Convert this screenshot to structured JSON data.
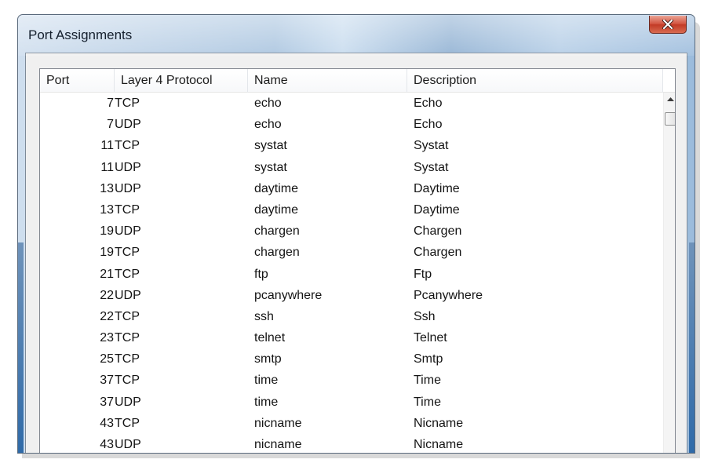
{
  "window": {
    "title": "Port Assignments",
    "close_icon": "close-x-icon"
  },
  "table": {
    "columns": [
      "Port",
      "Layer 4 Protocol",
      "Name",
      "Description"
    ],
    "rows": [
      {
        "port": "7",
        "protocol": "TCP",
        "name": "echo",
        "description": "Echo"
      },
      {
        "port": "7",
        "protocol": "UDP",
        "name": "echo",
        "description": "Echo"
      },
      {
        "port": "11",
        "protocol": "TCP",
        "name": "systat",
        "description": "Systat"
      },
      {
        "port": "11",
        "protocol": "UDP",
        "name": "systat",
        "description": "Systat"
      },
      {
        "port": "13",
        "protocol": "UDP",
        "name": "daytime",
        "description": "Daytime"
      },
      {
        "port": "13",
        "protocol": "TCP",
        "name": "daytime",
        "description": "Daytime"
      },
      {
        "port": "19",
        "protocol": "UDP",
        "name": "chargen",
        "description": "Chargen"
      },
      {
        "port": "19",
        "protocol": "TCP",
        "name": "chargen",
        "description": "Chargen"
      },
      {
        "port": "21",
        "protocol": "TCP",
        "name": "ftp",
        "description": "Ftp"
      },
      {
        "port": "22",
        "protocol": "UDP",
        "name": "pcanywhere",
        "description": "Pcanywhere"
      },
      {
        "port": "22",
        "protocol": "TCP",
        "name": "ssh",
        "description": "Ssh"
      },
      {
        "port": "23",
        "protocol": "TCP",
        "name": "telnet",
        "description": "Telnet"
      },
      {
        "port": "25",
        "protocol": "TCP",
        "name": "smtp",
        "description": "Smtp"
      },
      {
        "port": "37",
        "protocol": "TCP",
        "name": "time",
        "description": "Time"
      },
      {
        "port": "37",
        "protocol": "UDP",
        "name": "time",
        "description": "Time"
      },
      {
        "port": "43",
        "protocol": "TCP",
        "name": "nicname",
        "description": "Nicname"
      },
      {
        "port": "43",
        "protocol": "UDP",
        "name": "nicname",
        "description": "Nicname"
      }
    ]
  },
  "scrollbar": {
    "up_icon": "scroll-up-arrow-icon"
  },
  "colors": {
    "close_button": "#c94a35",
    "frame_accent": "#2f6aa8"
  }
}
